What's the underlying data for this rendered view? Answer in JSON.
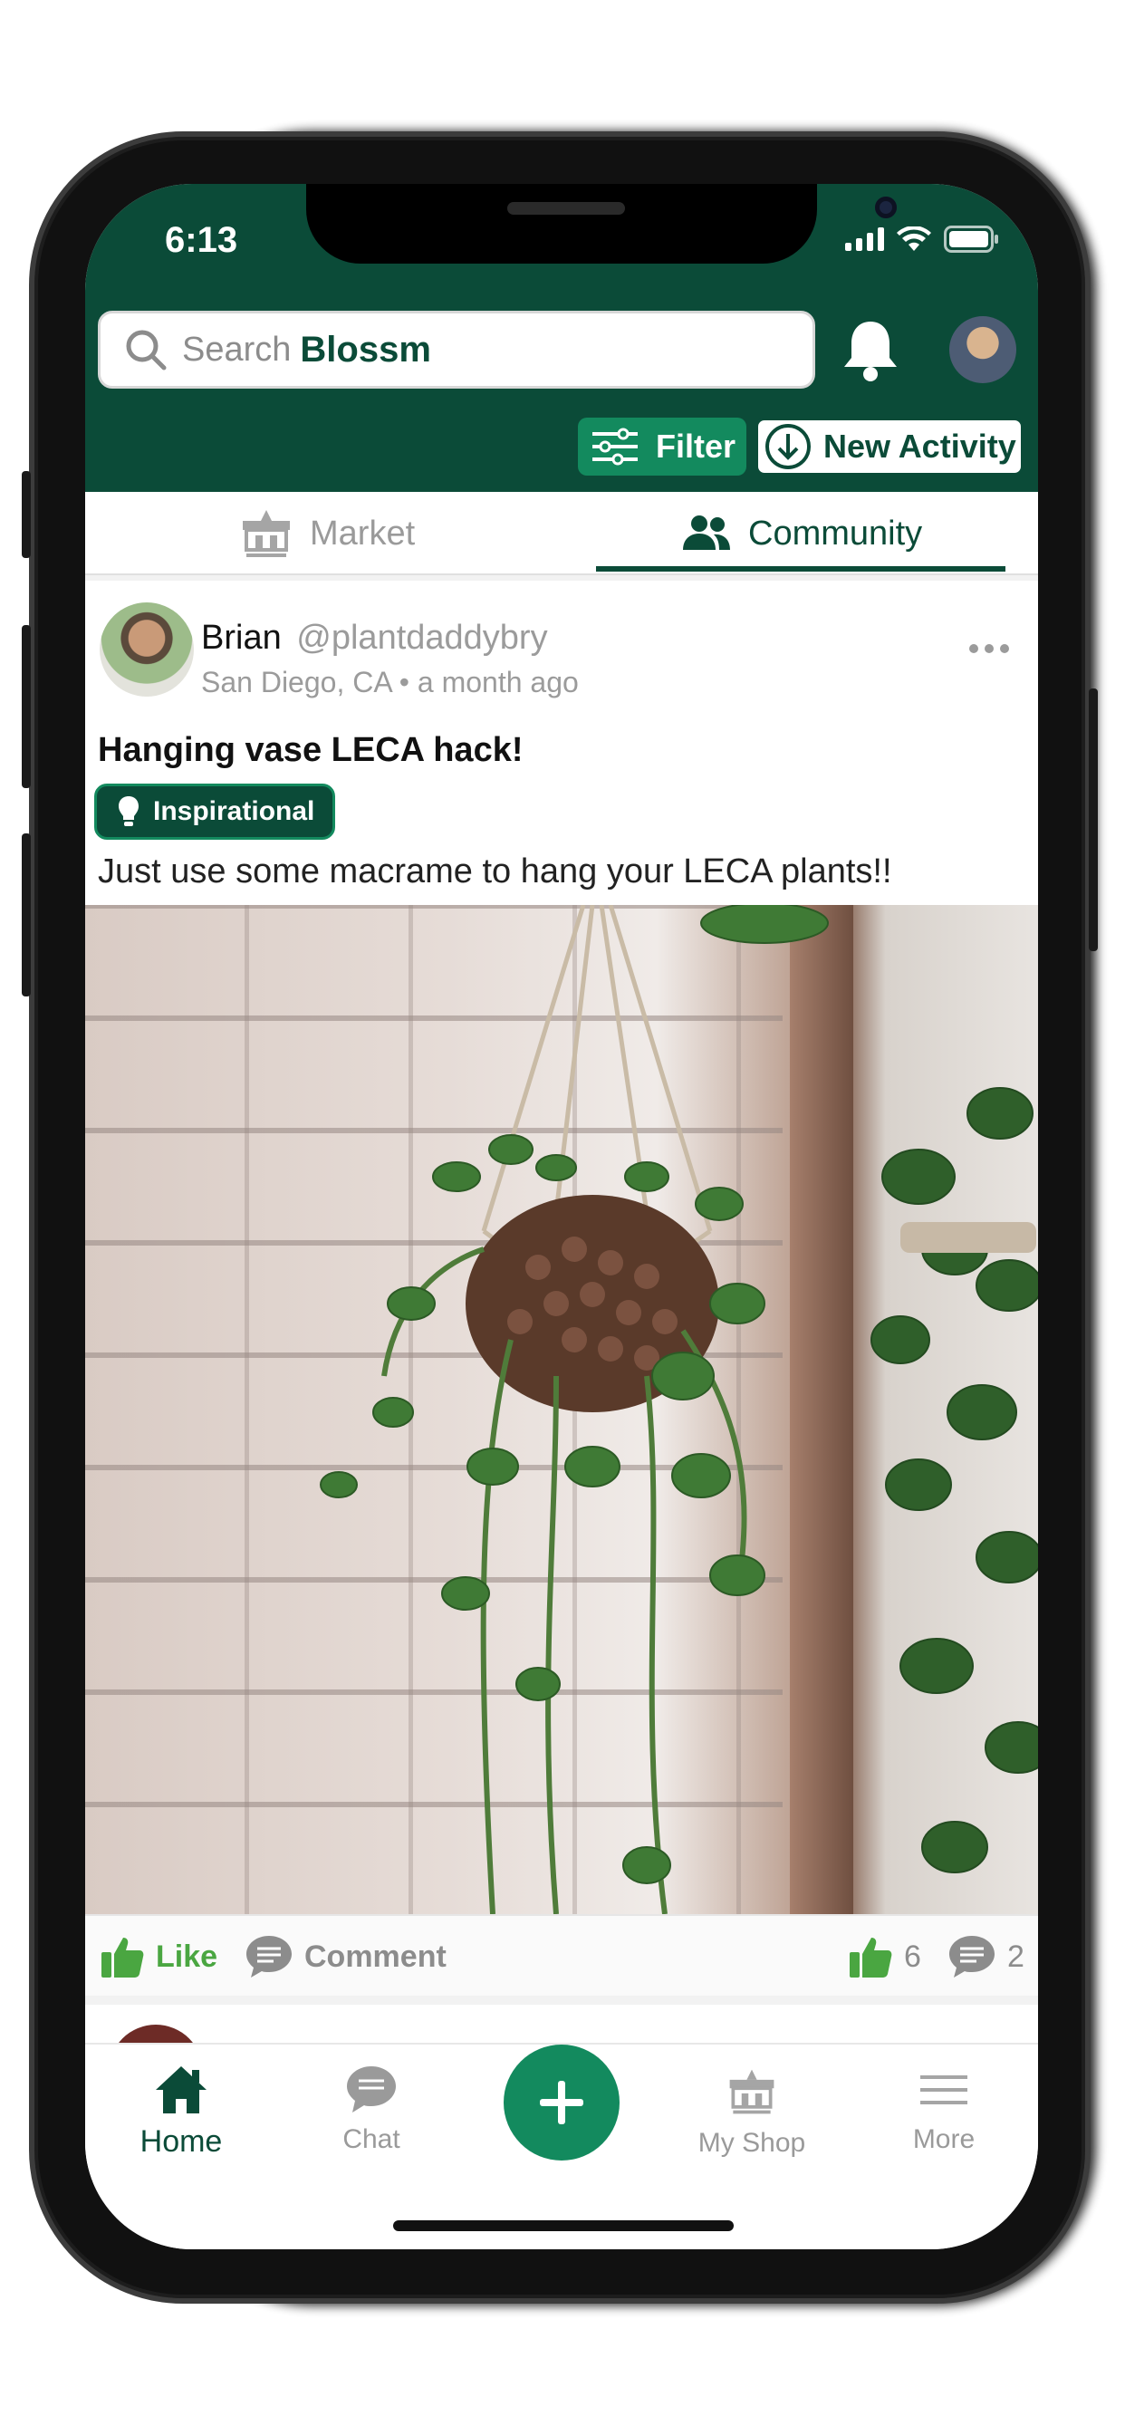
{
  "status_bar": {
    "time": "6:13"
  },
  "search": {
    "placeholder": "Search",
    "brand": "Blossm"
  },
  "header_actions": {
    "filter_label": "Filter",
    "new_activity_label": "New Activity"
  },
  "tabs": [
    {
      "label": "Market",
      "active": false
    },
    {
      "label": "Community",
      "active": true
    }
  ],
  "post": {
    "author_name": "Brian",
    "author_handle": "@plantdaddybry",
    "location_time": "San Diego, CA • a month ago",
    "title": "Hanging vase LECA hack!",
    "tag": "Inspirational",
    "body": "Just use some macrame to hang your LECA plants!!",
    "like_label": "Like",
    "comment_label": "Comment",
    "like_count": "6",
    "comment_count": "2"
  },
  "bottom_nav": {
    "home": "Home",
    "chat": "Chat",
    "shop": "My Shop",
    "more": "More"
  },
  "colors": {
    "brand_dark": "#0b4b38",
    "brand_accent": "#138a5e",
    "like_green": "#4aa641"
  }
}
